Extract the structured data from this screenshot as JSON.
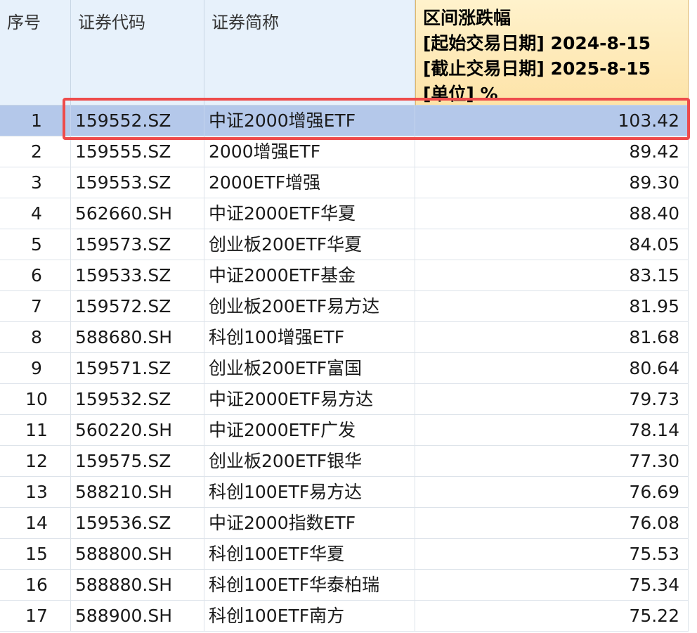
{
  "columns": {
    "index": "序号",
    "code": "证券代码",
    "name": "证券简称",
    "change_title": "区间涨跌幅",
    "change_start": "[起始交易日期] 2024-8-15",
    "change_end": "[截止交易日期] 2025-8-15",
    "change_unit": "[单位] %"
  },
  "selected_row": 1,
  "rows": [
    {
      "idx": "1",
      "code": "159552.SZ",
      "name": "中证2000增强ETF",
      "value": "103.42"
    },
    {
      "idx": "2",
      "code": "159555.SZ",
      "name": "2000增强ETF",
      "value": "89.42"
    },
    {
      "idx": "3",
      "code": "159553.SZ",
      "name": "2000ETF增强",
      "value": "89.30"
    },
    {
      "idx": "4",
      "code": "562660.SH",
      "name": "中证2000ETF华夏",
      "value": "88.40"
    },
    {
      "idx": "5",
      "code": "159573.SZ",
      "name": "创业板200ETF华夏",
      "value": "84.05"
    },
    {
      "idx": "6",
      "code": "159533.SZ",
      "name": "中证2000ETF基金",
      "value": "83.15"
    },
    {
      "idx": "7",
      "code": "159572.SZ",
      "name": "创业板200ETF易方达",
      "value": "81.95"
    },
    {
      "idx": "8",
      "code": "588680.SH",
      "name": "科创100增强ETF",
      "value": "81.68"
    },
    {
      "idx": "9",
      "code": "159571.SZ",
      "name": "创业板200ETF富国",
      "value": "80.64"
    },
    {
      "idx": "10",
      "code": "159532.SZ",
      "name": "中证2000ETF易方达",
      "value": "79.73"
    },
    {
      "idx": "11",
      "code": "560220.SH",
      "name": "中证2000ETF广发",
      "value": "78.14"
    },
    {
      "idx": "12",
      "code": "159575.SZ",
      "name": "创业板200ETF银华",
      "value": "77.30"
    },
    {
      "idx": "13",
      "code": "588210.SH",
      "name": "科创100ETF易方达",
      "value": "76.69"
    },
    {
      "idx": "14",
      "code": "159536.SZ",
      "name": "中证2000指数ETF",
      "value": "76.08"
    },
    {
      "idx": "15",
      "code": "588800.SH",
      "name": "科创100ETF华夏",
      "value": "75.53"
    },
    {
      "idx": "16",
      "code": "588880.SH",
      "name": "科创100ETF华泰柏瑞",
      "value": "75.34"
    },
    {
      "idx": "17",
      "code": "588900.SH",
      "name": "科创100ETF南方",
      "value": "75.22"
    }
  ],
  "colors": {
    "header_bg": "#e7f1fb",
    "sorted_header_bg": "#fde3a8",
    "selected_row_bg": "#b4c8ea",
    "highlight_border": "#ee4b4b"
  }
}
